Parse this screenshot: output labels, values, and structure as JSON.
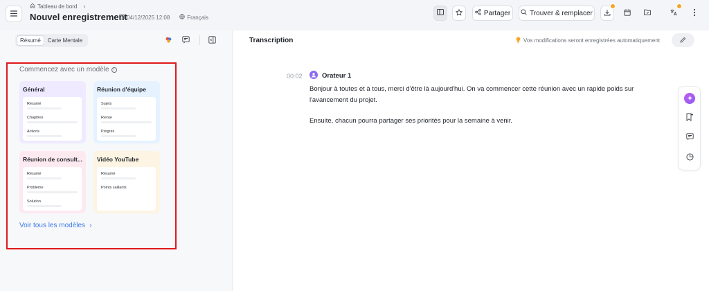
{
  "header": {
    "breadcrumb": "Tableau de bord",
    "title": "Nouvel enregistrement",
    "date": "04/12/2025 12:08",
    "language": "Français",
    "share_label": "Partager",
    "find_replace_label": "Trouver & remplacer",
    "accent_badge_color": "#f5a524"
  },
  "left_panel": {
    "tabs": [
      {
        "label": "Résumé",
        "active": true
      },
      {
        "label": "Carte Mentale",
        "active": false
      }
    ],
    "templates_heading": "Commencez avec un modèle",
    "templates": [
      {
        "title": "Général",
        "color": "#efeaff",
        "lines": [
          "Résumé",
          "Chapitres",
          "Actions"
        ]
      },
      {
        "title": "Réunion d'équipe",
        "color": "#e6f2ff",
        "lines": [
          "Sujets",
          "Revue",
          "Progrès"
        ]
      },
      {
        "title": "Réunion de consult...",
        "color": "#fdeaf0",
        "lines": [
          "Résumé",
          "Problème",
          "Solution"
        ]
      },
      {
        "title": "Vidéo YouTube",
        "color": "#fdf4e3",
        "lines": [
          "Résumé",
          "Points saillants"
        ]
      }
    ],
    "view_all_label": "Voir tous les modèles",
    "highlight_color": "#e0191b"
  },
  "right_panel": {
    "title": "Transcription",
    "autosave_notice": "Vos modifications seront enregistrées automatiquement",
    "segment": {
      "timestamp": "00:02",
      "speaker": "Orateur 1",
      "paragraphs": [
        "Bonjour à toutes et à tous, merci d'être là aujourd'hui. On va commencer cette réunion avec un rapide poids sur l'avancement du projet.",
        "Ensuite, chacun pourra partager ses priorités pour la semaine à venir."
      ]
    }
  }
}
